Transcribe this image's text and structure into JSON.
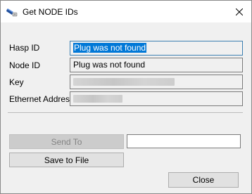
{
  "window": {
    "title": "Get NODE IDs",
    "icon": "key-plug-icon"
  },
  "fields": {
    "hasp_id": {
      "label": "Hasp ID",
      "value": "Plug was not found"
    },
    "node_id": {
      "label": "Node ID",
      "value": "Plug was not found"
    },
    "key": {
      "label": "Key"
    },
    "ethernet": {
      "label": "Ethernet Address"
    }
  },
  "buttons": {
    "send_to": "Send To",
    "save_to_file": "Save to File",
    "close": "Close"
  },
  "send_to_input": {
    "value": ""
  }
}
